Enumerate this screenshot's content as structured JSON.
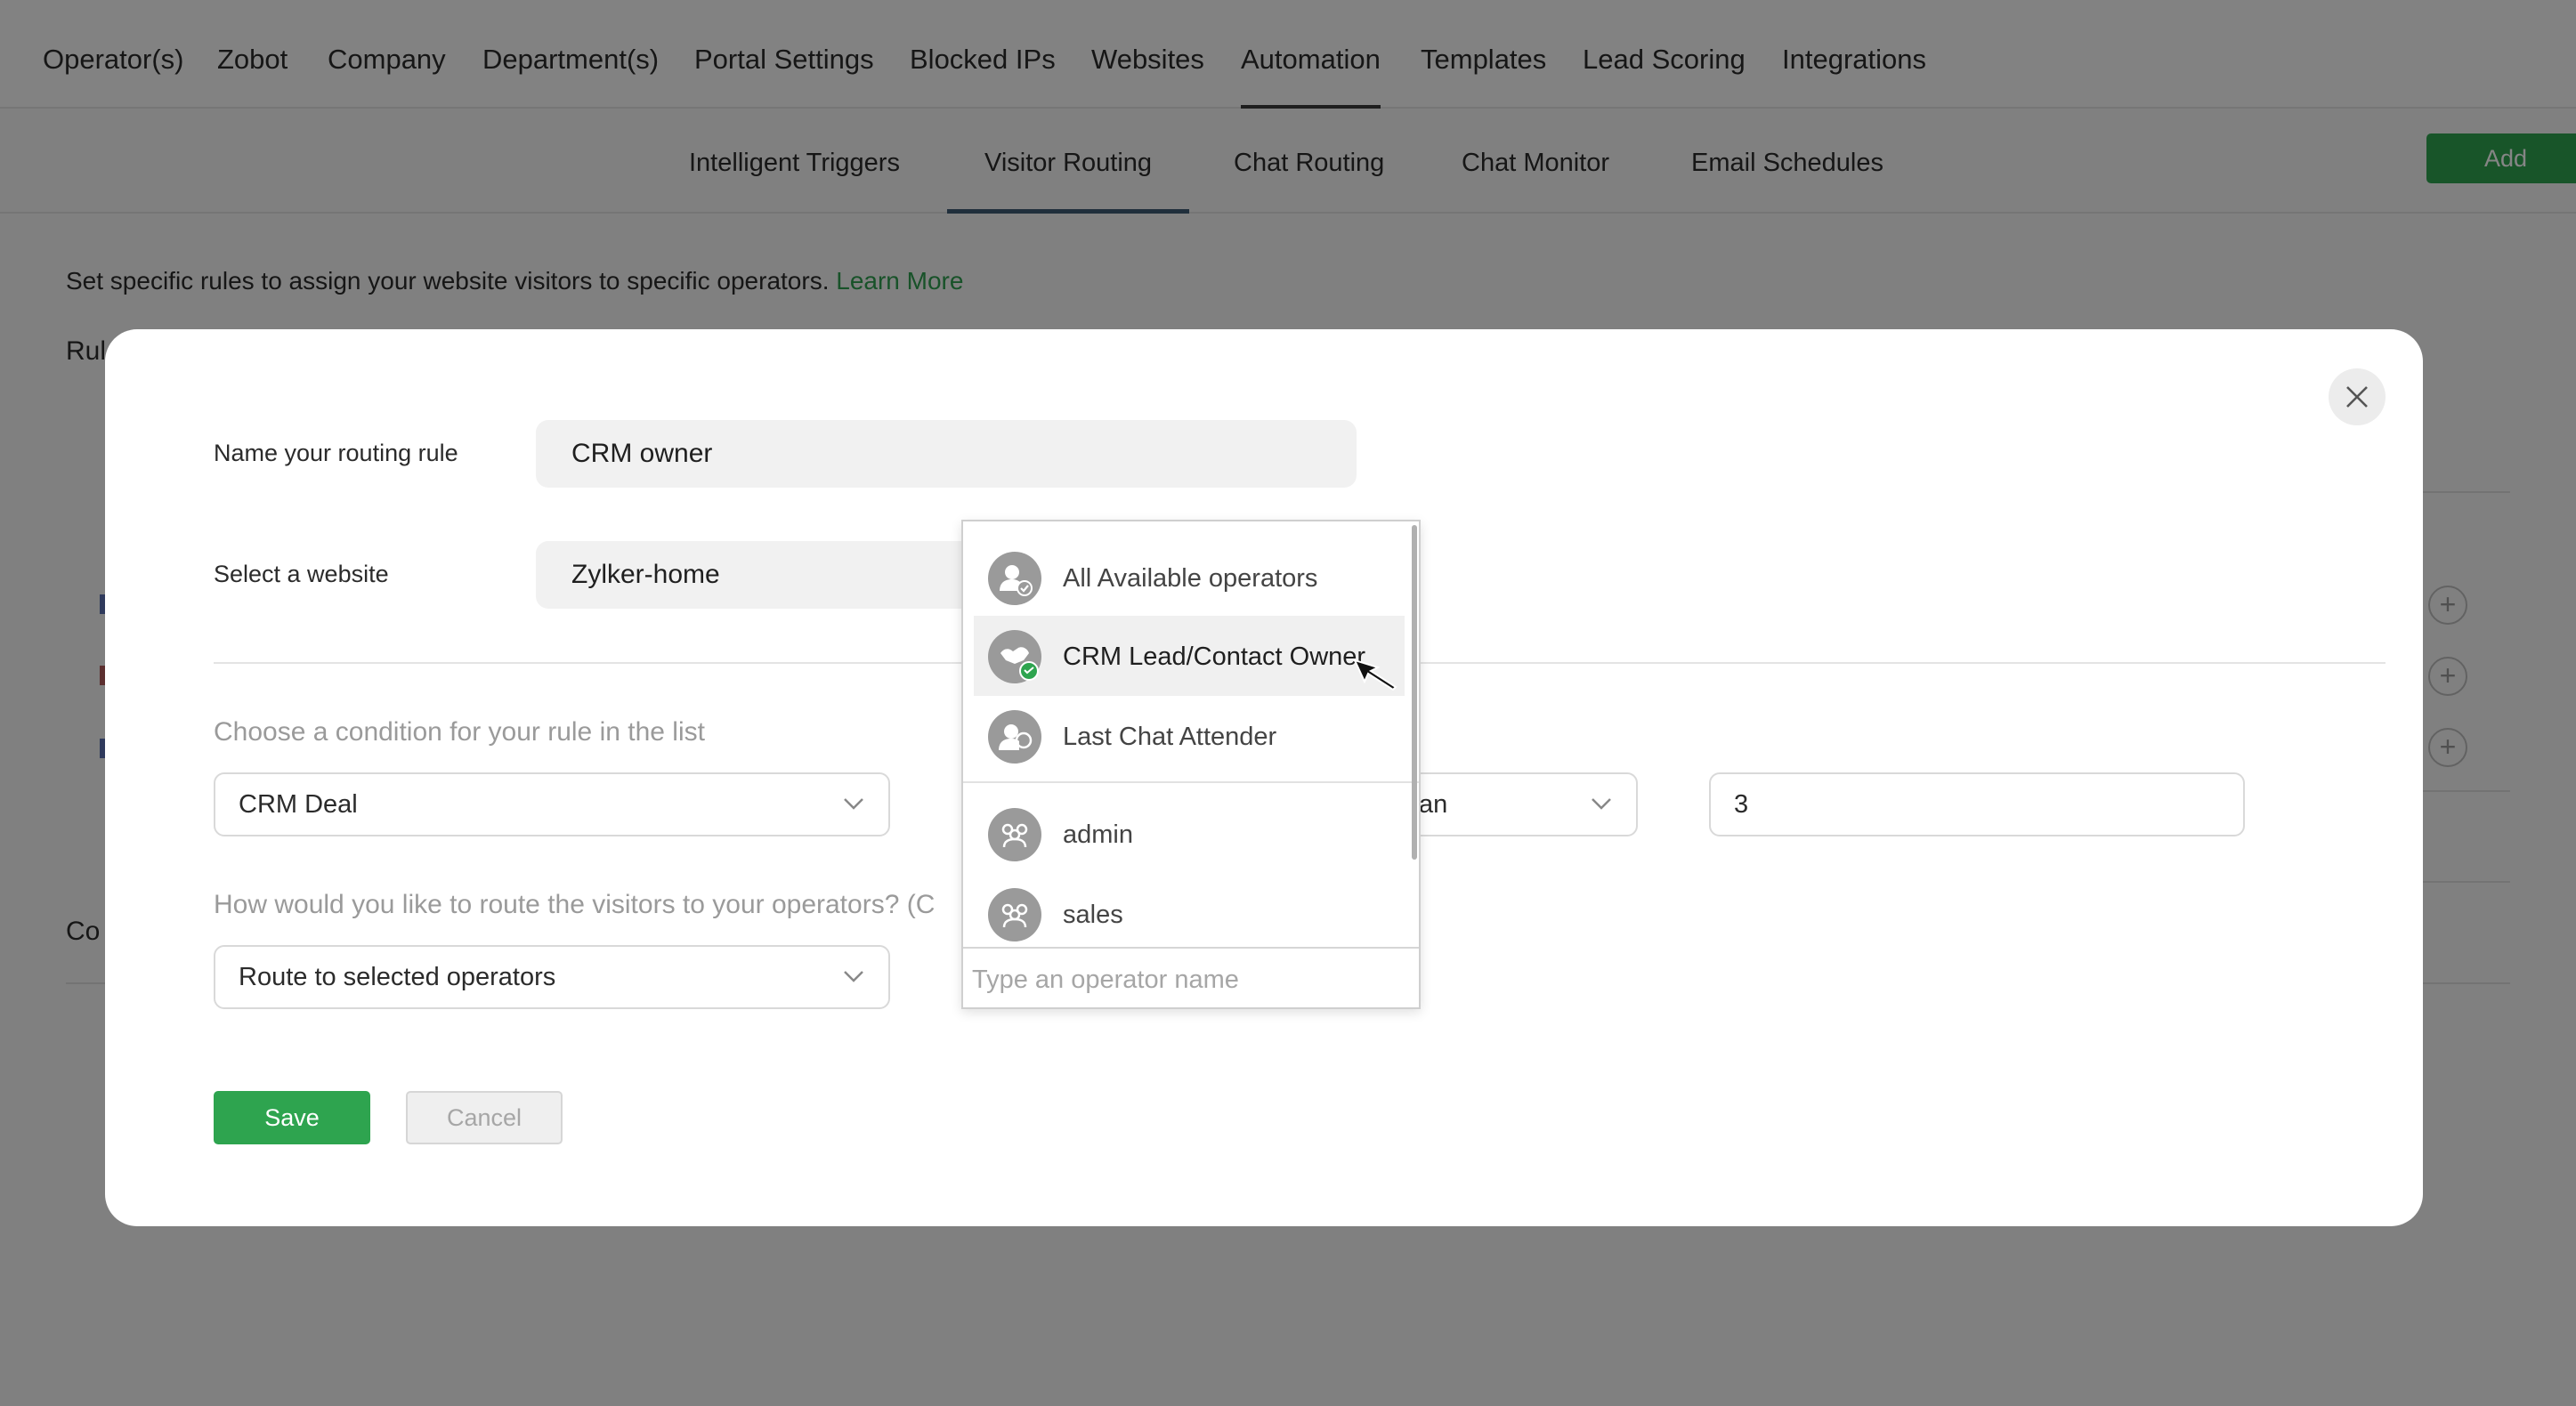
{
  "topnav": {
    "items": [
      "Operator(s)",
      "Zobot",
      "Company",
      "Department(s)",
      "Portal Settings",
      "Blocked IPs",
      "Websites",
      "Automation",
      "Templates",
      "Lead Scoring",
      "Integrations"
    ],
    "active": "Automation"
  },
  "subnav": {
    "items": [
      "Intelligent Triggers",
      "Visitor Routing",
      "Chat Routing",
      "Chat Monitor",
      "Email Schedules"
    ],
    "active": "Visitor Routing",
    "add_label": "Add"
  },
  "background": {
    "description": "Set specific rules to assign your website visitors to specific operators.",
    "learn_more": "Learn More",
    "frag_rules": "Rul",
    "frag_co": "Co"
  },
  "modal": {
    "name_label": "Name your routing rule",
    "name_value": "CRM owner",
    "website_label": "Select a website",
    "website_value": "Zylker-home",
    "condition_label": "Choose a condition for your rule in the list",
    "condition_value": "CRM Deal",
    "operator_value": "re than",
    "number_value": "3",
    "route_label": "How would you like to route the visitors to your operators? (C",
    "route_value": "Route to selected operators",
    "save_label": "Save",
    "cancel_label": "Cancel"
  },
  "dropdown": {
    "options": [
      {
        "label": "All Available operators",
        "icon": "user-check-icon"
      },
      {
        "label": "CRM Lead/Contact Owner",
        "icon": "crm-owner-icon",
        "highlighted": true
      },
      {
        "label": "Last Chat Attender",
        "icon": "user-chat-icon"
      },
      {
        "label": "admin",
        "icon": "group-icon"
      },
      {
        "label": "sales",
        "icon": "group-icon"
      }
    ],
    "search_placeholder": "Type an operator name"
  },
  "colors": {
    "accent_green": "#2ea44f",
    "link_green": "#2e9e4f",
    "overlay": "rgba(0,0,0,0.48)"
  }
}
